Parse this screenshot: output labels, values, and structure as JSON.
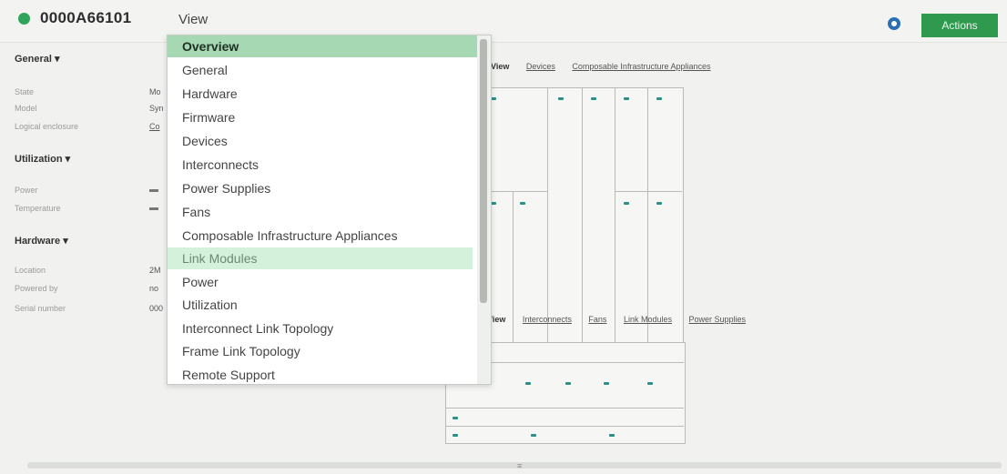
{
  "header": {
    "resource_name": "0000A66101",
    "view_label": "View",
    "actions_label": "Actions",
    "status_color": "#31a35b"
  },
  "left": {
    "general": {
      "title": "General",
      "rows": [
        {
          "label": "State",
          "value": "Mo"
        },
        {
          "label": "Model",
          "value": "Syn"
        },
        {
          "label": "Logical enclosure",
          "value": "Co"
        }
      ]
    },
    "utilization": {
      "title": "Utilization",
      "rows": [
        {
          "label": "Power",
          "value": ""
        },
        {
          "label": "Temperature",
          "value": ""
        }
      ]
    },
    "hardware": {
      "title": "Hardware",
      "rows": [
        {
          "label": "Location",
          "value": "2M"
        },
        {
          "label": "Powered by",
          "value": "no"
        },
        {
          "label": "Serial number",
          "value": "000"
        }
      ]
    }
  },
  "main": {
    "tabs_top": {
      "active": "View",
      "items": [
        "Devices",
        "Composable Infrastructure Appliances"
      ]
    },
    "tabs_bottom": {
      "active": "View",
      "items": [
        "Interconnects",
        "Fans",
        "Link Modules",
        "Power Supplies"
      ]
    }
  },
  "menu": {
    "items": [
      "Overview",
      "General",
      "Hardware",
      "Firmware",
      "Devices",
      "Interconnects",
      "Power Supplies",
      "Fans",
      "Composable Infrastructure Appliances",
      "Link Modules",
      "Power",
      "Utilization",
      "Interconnect Link Topology",
      "Frame Link Topology",
      "Remote Support"
    ],
    "selected": "Overview",
    "hovered": "Link Modules"
  },
  "icons": {
    "help": "help-icon",
    "status": "status-dot-icon",
    "port": "port-indicator-icon"
  },
  "colors": {
    "accent": "#2f9a4e",
    "selected_item": "#a6d8b4",
    "hover_item": "#d4f1dc",
    "port": "#2a8f86"
  }
}
